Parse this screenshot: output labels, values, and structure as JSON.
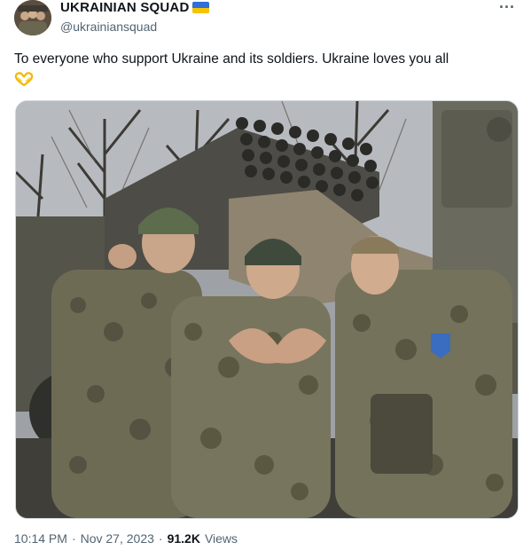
{
  "author": {
    "display_name": "UKRAINIAN SQUAD",
    "handle": "@ukrainiansquad",
    "verified_flag": "ukraine-flag-icon"
  },
  "menu": {
    "more_label": "···"
  },
  "tweet": {
    "text": "To everyone who support Ukraine and its soldiers. Ukraine loves you all",
    "emoji_icon": "heart-hands-icon",
    "photo_icon": "photo-soldiers-rocket-launcher"
  },
  "meta": {
    "time": "10:14 PM",
    "dot1": "·",
    "date": "Nov 27, 2023",
    "dot2": "·",
    "views_count": "91.2K",
    "views_label": "Views"
  },
  "colors": {
    "text": "#0f1419",
    "secondary": "#536471",
    "flag_blue": "#2f6fd6",
    "flag_yellow": "#f5c400",
    "border": "#cfd9de"
  }
}
